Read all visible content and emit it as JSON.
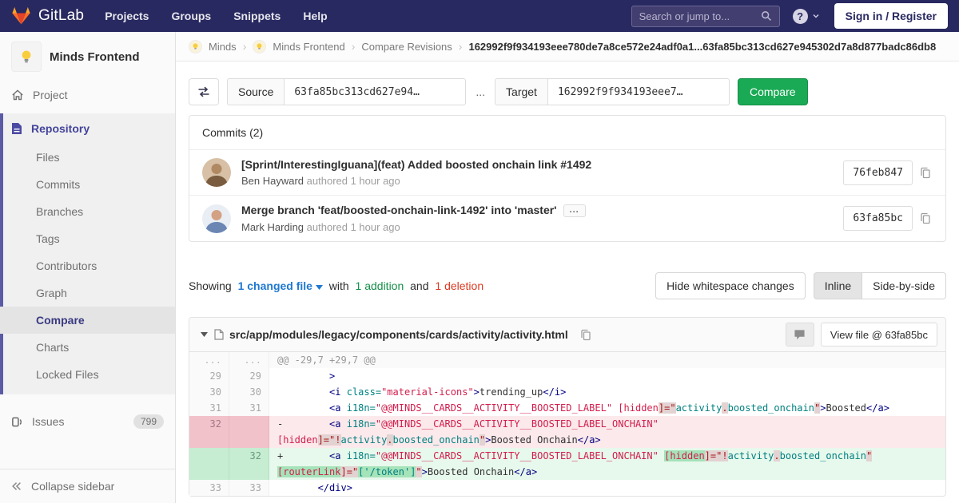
{
  "colors": {
    "navbar_bg": "#292961",
    "sidebar_accent": "#5a5aa5",
    "active_indigo": "#44449b",
    "button_green": "#1aaa55",
    "link_blue": "#1f78d1",
    "addition_green": "#168f48",
    "deletion_red": "#db3b21",
    "diff_add_bg": "#e7f8ec",
    "diff_del_bg": "#fbe9eb"
  },
  "navbar": {
    "logo_text": "GitLab",
    "links": [
      "Projects",
      "Groups",
      "Snippets",
      "Help"
    ],
    "search_placeholder": "Search or jump to...",
    "help_glyph": "?",
    "signin_label": "Sign in / Register"
  },
  "sidebar": {
    "project_name": "Minds Frontend",
    "top_item": {
      "label": "Project",
      "icon": "home-icon"
    },
    "section": {
      "label": "Repository",
      "icon": "document-icon",
      "items": [
        {
          "label": "Files"
        },
        {
          "label": "Commits"
        },
        {
          "label": "Branches"
        },
        {
          "label": "Tags"
        },
        {
          "label": "Contributors"
        },
        {
          "label": "Graph"
        },
        {
          "label": "Compare",
          "active": true
        },
        {
          "label": "Charts"
        },
        {
          "label": "Locked Files"
        }
      ]
    },
    "issues": {
      "label": "Issues",
      "count": "799",
      "icon": "issues-icon"
    },
    "collapse_label": "Collapse sidebar"
  },
  "breadcrumb": {
    "crumbs": [
      "Minds",
      "Minds Frontend",
      "Compare Revisions"
    ],
    "sha_range": "162992f9f934193eee780de7a8ce572e24adf0a1...63fa85bc313cd627e945302d7a8d877badc86db8"
  },
  "form": {
    "source_label": "Source",
    "source_value": "63fa85bc313cd627e94…",
    "separator": "...",
    "target_label": "Target",
    "target_value": "162992f9f934193eee7…",
    "compare_label": "Compare"
  },
  "commits": {
    "header": "Commits (2)",
    "items": [
      {
        "title": "[Sprint/InterestingIguana](feat) Added boosted onchain link #1492",
        "author": "Ben Hayward",
        "meta": " authored 1 hour ago",
        "sha": "76feb847",
        "expander_label": "",
        "avatar": {
          "bg": "#d7c0a5",
          "head": "#b08963",
          "body": "#7a5c40"
        }
      },
      {
        "title": "Merge branch 'feat/boosted-onchain-link-1492' into 'master'",
        "author": "Mark Harding",
        "meta": " authored 1 hour ago",
        "sha": "63fa85bc",
        "expander_label": "...",
        "avatar": {
          "bg": "#e9eef4",
          "head": "#d3a183",
          "body": "#6b86b3"
        }
      }
    ]
  },
  "summary": {
    "showing": "Showing",
    "changed_files": "1 changed file",
    "with_text": "with",
    "additions": "1 addition",
    "and_text": "and",
    "deletions": "1 deletion",
    "hide_whitespace": "Hide whitespace changes",
    "inline": "Inline",
    "side_by_side": "Side-by-side"
  },
  "diff": {
    "file_path": "src/app/modules/legacy/components/cards/activity/activity.html",
    "view_file_label": "View file @ 63fa85bc",
    "rows": [
      {
        "type": "match",
        "old": "...",
        "new": "...",
        "segs": [
          {
            "t": "@@ -29,7 +29,7 @@",
            "c": "mt"
          }
        ]
      },
      {
        "type": "ctx",
        "old": "29",
        "new": "29",
        "segs": [
          {
            "t": "         ",
            "c": "pl"
          },
          {
            "t": ">",
            "c": "nt"
          }
        ]
      },
      {
        "type": "ctx",
        "old": "30",
        "new": "30",
        "segs": [
          {
            "t": "         ",
            "c": "pl"
          },
          {
            "t": "<i",
            "c": "nt"
          },
          {
            "t": " ",
            "c": "pl"
          },
          {
            "t": "class=",
            "c": "na"
          },
          {
            "t": "\"material-icons\"",
            "c": "s"
          },
          {
            "t": ">",
            "c": "nt"
          },
          {
            "t": "trending_up",
            "c": "pl"
          },
          {
            "t": "</i>",
            "c": "nt"
          }
        ]
      },
      {
        "type": "ctx",
        "old": "31",
        "new": "31",
        "segs": [
          {
            "t": "         ",
            "c": "pl"
          },
          {
            "t": "<a",
            "c": "nt"
          },
          {
            "t": " ",
            "c": "pl"
          },
          {
            "t": "i18n=",
            "c": "na"
          },
          {
            "t": "\"@@MINDS__CARDS__ACTIVITY__BOOSTED_LABEL\"",
            "c": "s"
          },
          {
            "t": " ",
            "c": "pl"
          },
          {
            "t": "[hidden",
            "c": "s"
          },
          {
            "t": "]=\"",
            "c": "err"
          },
          {
            "t": "activity",
            "c": "na"
          },
          {
            "t": ".",
            "c": "err"
          },
          {
            "t": "boosted_onchain",
            "c": "na"
          },
          {
            "t": "\"",
            "c": "err"
          },
          {
            "t": ">",
            "c": "nt"
          },
          {
            "t": "Boosted",
            "c": "pl"
          },
          {
            "t": "</a>",
            "c": "nt"
          }
        ]
      },
      {
        "type": "del",
        "old": "32",
        "new": "",
        "segs": [
          {
            "t": "-        ",
            "c": "pl"
          },
          {
            "t": "<a",
            "c": "nt"
          },
          {
            "t": " ",
            "c": "pl"
          },
          {
            "t": "i18n=",
            "c": "na"
          },
          {
            "t": "\"@@MINDS__CARDS__ACTIVITY__BOOSTED_LABEL_ONCHAIN\"",
            "c": "s"
          },
          {
            "t": " ",
            "c": "pl"
          },
          {
            "t": "[hidden",
            "c": "s"
          },
          {
            "t": "]=\"",
            "c": "err"
          },
          {
            "t": "!",
            "c": "err"
          },
          {
            "t": "activity",
            "c": "na"
          },
          {
            "t": ".",
            "c": "err"
          },
          {
            "t": "boosted_onchain",
            "c": "na"
          },
          {
            "t": "\"",
            "c": "err"
          },
          {
            "t": ">",
            "c": "nt"
          },
          {
            "t": "Boosted Onchain",
            "c": "pl"
          },
          {
            "t": "</a>",
            "c": "nt"
          }
        ]
      },
      {
        "type": "add",
        "old": "",
        "new": "32",
        "segs": [
          {
            "t": "+        ",
            "c": "pl"
          },
          {
            "t": "<a",
            "c": "nt"
          },
          {
            "t": " ",
            "c": "pl"
          },
          {
            "t": "i18n=",
            "c": "na"
          },
          {
            "t": "\"@@MINDS__CARDS__ACTIVITY__BOOSTED_LABEL_ONCHAIN\"",
            "c": "s"
          },
          {
            "t": " ",
            "c": "pl"
          },
          {
            "t": "[hidden",
            "c": "s mk"
          },
          {
            "t": "]=\"",
            "c": "err"
          },
          {
            "t": "!",
            "c": "err mk"
          },
          {
            "t": "activity",
            "c": "na"
          },
          {
            "t": ".",
            "c": "err"
          },
          {
            "t": "boosted_onchain",
            "c": "na"
          },
          {
            "t": "\"",
            "c": "err mk"
          },
          {
            "t": " ",
            "c": "pl"
          },
          {
            "t": "[routerLink",
            "c": "s mk"
          },
          {
            "t": "]=\"",
            "c": "err mk"
          },
          {
            "t": "['/token']",
            "c": "na mk"
          },
          {
            "t": "\"",
            "c": "err mk"
          },
          {
            "t": ">",
            "c": "nt"
          },
          {
            "t": "Boosted Onchain",
            "c": "pl"
          },
          {
            "t": "</a>",
            "c": "nt"
          }
        ]
      },
      {
        "type": "ctx",
        "old": "33",
        "new": "33",
        "segs": [
          {
            "t": "       ",
            "c": "pl"
          },
          {
            "t": "</div>",
            "c": "nt"
          }
        ]
      }
    ]
  }
}
